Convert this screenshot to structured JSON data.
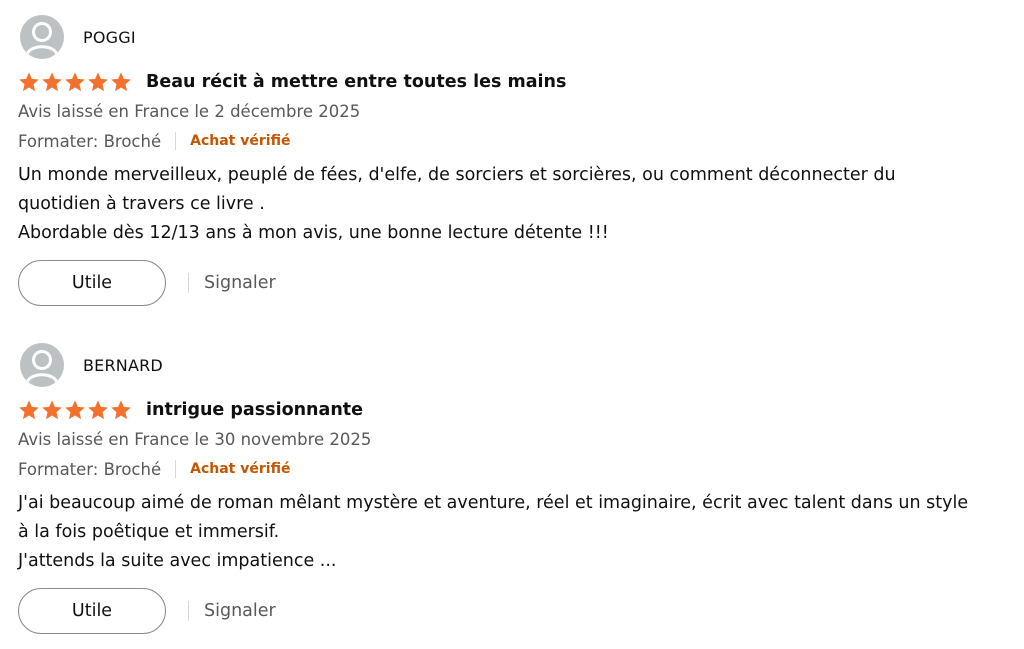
{
  "colors": {
    "star": "#f2712e",
    "verified": "#c45500",
    "meta": "#565959",
    "avatar": "#bcc1c4"
  },
  "icons": {
    "avatar": "user-avatar-icon",
    "star": "star-icon"
  },
  "reviews": [
    {
      "profile_name": "POGGI",
      "rating": 5,
      "title": "Beau récit à mettre entre toutes les mains",
      "date": "Avis laissé en France le 2 décembre 2025",
      "format": "Formater: Broché",
      "verified": "Achat vérifié",
      "body": [
        "Un monde merveilleux, peuplé de fées, d'elfe, de sorciers et sorcières, ou comment déconnecter du",
        "quotidien à travers ce livre .",
        "Abordable dès 12/13 ans à mon avis, une bonne lecture détente !!!"
      ],
      "helpful_label": "Utile",
      "report_label": "Signaler"
    },
    {
      "profile_name": "BERNARD",
      "rating": 5,
      "title": "intrigue passionnante",
      "date": "Avis laissé en France le 30 novembre 2025",
      "format": "Formater: Broché",
      "verified": "Achat vérifié",
      "body": [
        "J'ai beaucoup aimé de roman mêlant mystère et aventure, réel et imaginaire, écrit avec talent dans un style",
        "à la fois poêtique et immersif.",
        "J'attends la suite avec impatience ..."
      ],
      "helpful_label": "Utile",
      "report_label": "Signaler"
    }
  ]
}
